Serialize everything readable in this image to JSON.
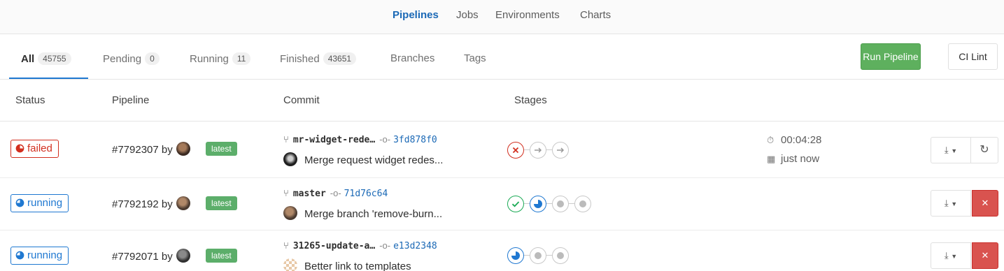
{
  "nav": {
    "items": [
      {
        "label": "Pipelines",
        "active": true
      },
      {
        "label": "Jobs",
        "active": false
      },
      {
        "label": "Environments",
        "active": false
      },
      {
        "label": "Charts",
        "active": false
      }
    ]
  },
  "tabs": [
    {
      "label": "All",
      "count": "45755",
      "active": true
    },
    {
      "label": "Pending",
      "count": "0",
      "active": false
    },
    {
      "label": "Running",
      "count": "11",
      "active": false
    },
    {
      "label": "Finished",
      "count": "43651",
      "active": false
    },
    {
      "label": "Branches",
      "active": false
    },
    {
      "label": "Tags",
      "active": false
    }
  ],
  "buttons": {
    "run_pipeline": "Run Pipeline",
    "ci_lint": "CI Lint"
  },
  "table": {
    "headers": {
      "status": "Status",
      "pipeline": "Pipeline",
      "commit": "Commit",
      "stages": "Stages"
    },
    "rows": [
      {
        "status": "failed",
        "pipeline": "#7792307 by",
        "badge": "latest",
        "branch": "mr-widget-rede…",
        "sha": "3fd878f0",
        "message": "Merge request widget redes...",
        "stages": [
          "failed",
          "skipped",
          "skipped"
        ],
        "duration": "00:04:28",
        "finished": "just now",
        "action": "retry"
      },
      {
        "status": "running",
        "pipeline": "#7792192 by",
        "badge": "latest",
        "branch": "master",
        "sha": "71d76c64",
        "message": "Merge branch 'remove-burn...",
        "stages": [
          "success",
          "running",
          "created",
          "created"
        ],
        "action": "cancel"
      },
      {
        "status": "running",
        "pipeline": "#7792071 by",
        "badge": "latest",
        "branch": "31265-update-a…",
        "sha": "e13d2348",
        "message": "Better link to templates",
        "stages": [
          "running",
          "created",
          "created"
        ],
        "action": "cancel"
      }
    ]
  },
  "colors": {
    "accent": "#1f78d1",
    "failed": "#d22f1f",
    "success": "#1aaa55",
    "run_button": "#5eb05e",
    "cancel": "#d9534f"
  }
}
